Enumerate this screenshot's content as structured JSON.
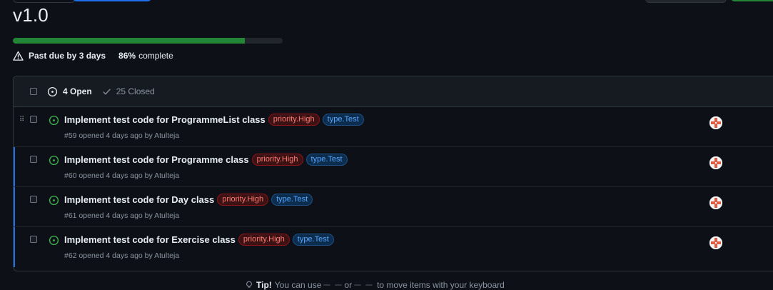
{
  "milestone": {
    "title": "v1.0",
    "progress_percent": 86,
    "due_text": "Past due by 3 days",
    "complete_pct": "86%",
    "complete_label": "complete"
  },
  "filters": {
    "open_label": "4 Open",
    "closed_label": "25 Closed"
  },
  "issues": [
    {
      "title": "Implement test code for ProgrammeList class",
      "labels": [
        "priority.High",
        "type.Test"
      ],
      "meta": "#59 opened 4 days ago by Atulteja"
    },
    {
      "title": "Implement test code for Programme class",
      "labels": [
        "priority.High",
        "type.Test"
      ],
      "meta": "#60 opened 4 days ago by Atulteja"
    },
    {
      "title": "Implement test code for Day class",
      "labels": [
        "priority.High",
        "type.Test"
      ],
      "meta": "#61 opened 4 days ago by Atulteja"
    },
    {
      "title": "Implement test code for Exercise class",
      "labels": [
        "priority.High",
        "type.Test"
      ],
      "meta": "#62 opened 4 days ago by Atulteja"
    }
  ],
  "tip": {
    "label": "Tip!",
    "text_a": "You can use",
    "key_a": "",
    "key_b": "",
    "text_or": "or",
    "key_c": "",
    "key_d": "",
    "text_b": "to move items with your keyboard"
  },
  "colors": {
    "background": "#0d1117",
    "open_green": "#3fb950",
    "progress_green": "#238636",
    "priority_red": "#ff7b72",
    "type_blue": "#58a6ff",
    "selection_blue": "#1f6feb"
  },
  "icons": {
    "warning": "alert-icon",
    "open_issue": "issue-opened-icon",
    "closed": "check-icon",
    "drag": "grabber-icon"
  }
}
